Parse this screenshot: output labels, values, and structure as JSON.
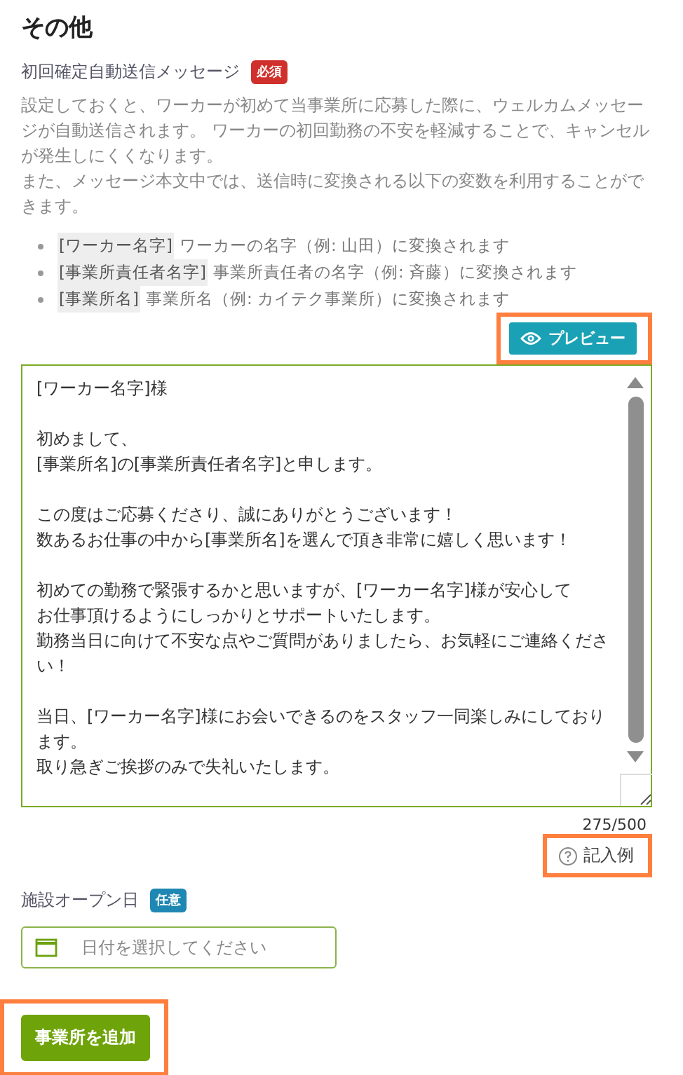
{
  "section_title": "その他",
  "message_field": {
    "label": "初回確定自動送信メッセージ",
    "badge": "必須",
    "description": [
      "設定しておくと、ワーカーが初めて当事業所に応募した際に、ウェルカムメッセージが自動送信されます。 ワーカーの初回勤務の不安を軽減することで、キャンセルが発生しにくくなります。",
      "また、メッセージ本文中では、送信時に変換される以下の変数を利用することができます。"
    ],
    "variables": [
      {
        "code": "[ワーカー名字]",
        "text": "ワーカーの名字（例: 山田）に変換されます"
      },
      {
        "code": "[事業所責任者名字]",
        "text": "事業所責任者の名字（例: 斉藤）に変換されます"
      },
      {
        "code": "[事業所名]",
        "text": "事業所名（例: カイテク事業所）に変換されます"
      }
    ],
    "preview_button": {
      "label": "プレビュー",
      "highlighted": true
    },
    "value": [
      [
        "[ワーカー名字]様"
      ],
      [
        "初めまして、",
        "[事業所名]の[事業所責任者名字]と申します。"
      ],
      [
        "この度はご応募くださり、誠にありがとうございます！",
        "数あるお仕事の中から[事業所名]を選んで頂き非常に嬉しく思います！"
      ],
      [
        "初めての勤務で緊張するかと思いますが、[ワーカー名字]様が安心して",
        "お仕事頂けるようにしっかりとサポートいたします。",
        "勤務当日に向けて不安な点やご質問がありましたら、お気軽にご連絡ください！"
      ],
      [
        "当日、[ワーカー名字]様にお会いできるのをスタッフ一同楽しみにしております。",
        "取り急ぎご挨拶のみで失礼いたします。"
      ]
    ],
    "counter": "275/500",
    "example_link": {
      "label": "記入例",
      "highlighted": true
    }
  },
  "open_date_field": {
    "label": "施設オープン日",
    "badge": "任意",
    "placeholder": "日付を選択してください"
  },
  "add_button": {
    "label": "事業所を追加",
    "highlighted": true
  }
}
